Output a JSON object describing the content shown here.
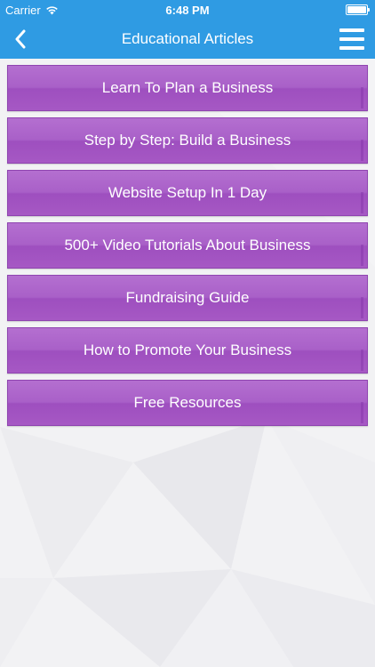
{
  "status": {
    "carrier": "Carrier",
    "time": "6:48 PM"
  },
  "nav": {
    "title": "Educational Articles"
  },
  "articles": [
    {
      "label": "Learn To Plan a Business"
    },
    {
      "label": "Step by Step: Build a Business"
    },
    {
      "label": "Website Setup In 1 Day"
    },
    {
      "label": "500+ Video Tutorials About Business"
    },
    {
      "label": "Fundraising Guide"
    },
    {
      "label": "How to Promote Your Business"
    },
    {
      "label": "Free Resources"
    }
  ],
  "colors": {
    "header": "#2f9be3",
    "item": "#a960c8",
    "background": "#f1f1f3"
  }
}
